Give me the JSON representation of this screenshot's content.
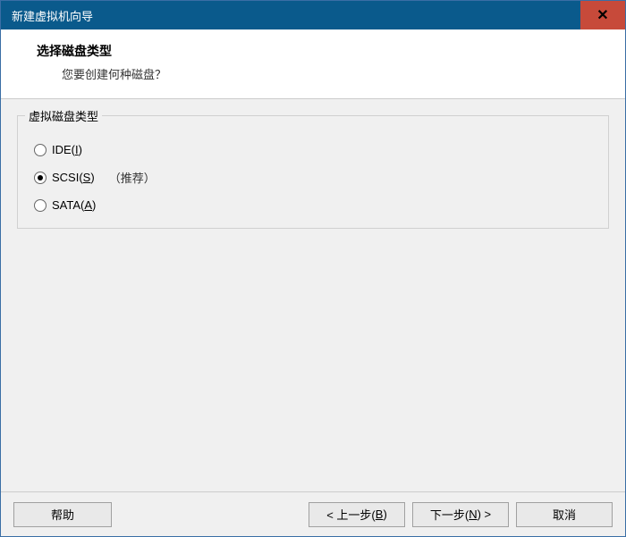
{
  "window": {
    "title": "新建虚拟机向导"
  },
  "header": {
    "title": "选择磁盘类型",
    "subtitle": "您要创建何种磁盘？"
  },
  "group": {
    "title": "虚拟磁盘类型",
    "options": {
      "opt0": {
        "prefix": "IDE(",
        "hotkey": "I",
        "suffix": ")",
        "selected": false,
        "recommend": ""
      },
      "opt1": {
        "prefix": "SCSI(",
        "hotkey": "S",
        "suffix": ")",
        "selected": true,
        "recommend": "（推荐）"
      },
      "opt2": {
        "prefix": "SATA(",
        "hotkey": "A",
        "suffix": ")",
        "selected": false,
        "recommend": ""
      }
    }
  },
  "buttons": {
    "help": "帮助",
    "back_prefix": "< 上一步(",
    "back_hotkey": "B",
    "back_suffix": ")",
    "next_prefix": "下一步(",
    "next_hotkey": "N",
    "next_suffix": ") >",
    "cancel": "取消"
  }
}
